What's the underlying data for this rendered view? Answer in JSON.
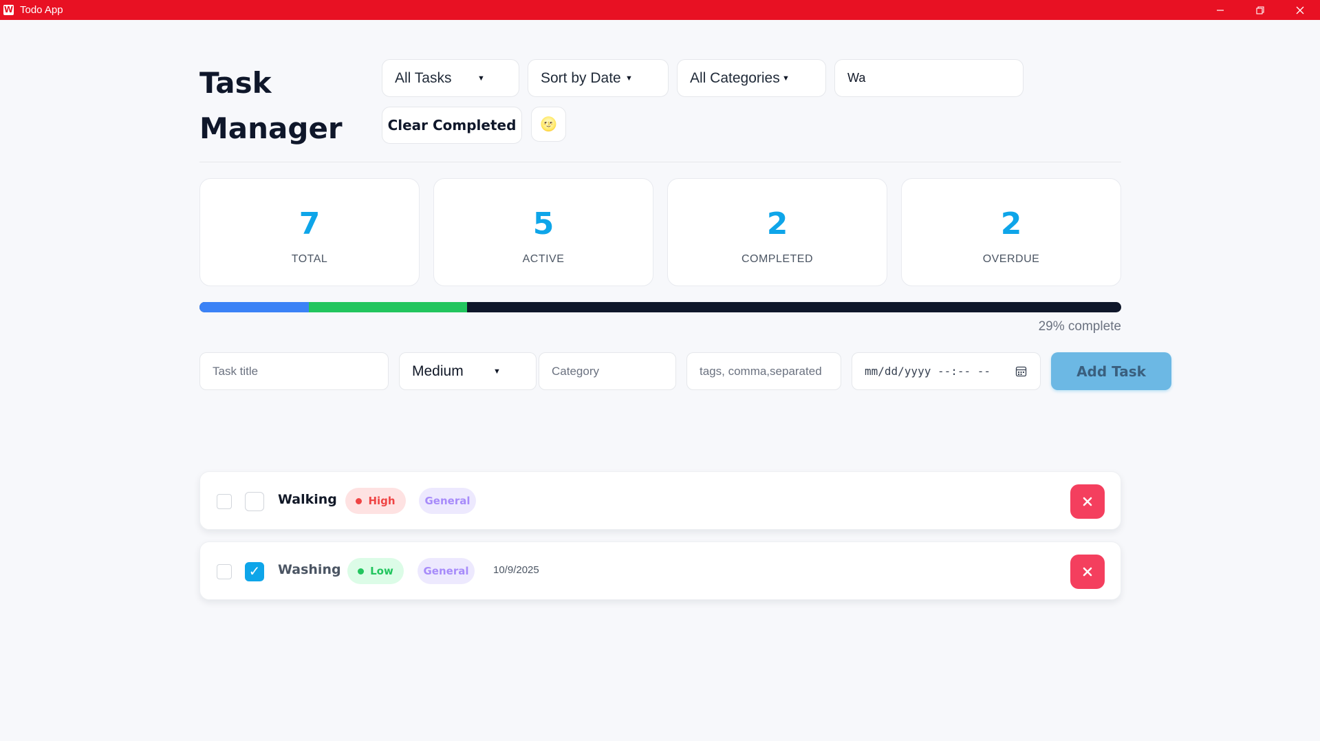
{
  "window": {
    "title": "Todo App",
    "icon_letter": "W"
  },
  "header": {
    "title": "Task Manager",
    "filter": {
      "value": "All Tasks"
    },
    "sort": {
      "value": "Sort by Date"
    },
    "category": {
      "value": "All Categories"
    },
    "search": {
      "value": "Wa"
    },
    "clear_label": "Clear Completed",
    "theme_icon": "🌝"
  },
  "stats": [
    {
      "value": "7",
      "label": "TOTAL"
    },
    {
      "value": "5",
      "label": "ACTIVE"
    },
    {
      "value": "2",
      "label": "COMPLETED"
    },
    {
      "value": "2",
      "label": "OVERDUE"
    }
  ],
  "progress": {
    "percent": 29,
    "text": "29% complete",
    "colors": [
      "#3b82f6",
      "#22c55e"
    ]
  },
  "form": {
    "title_placeholder": "Task title",
    "priority_value": "Medium",
    "category_placeholder": "Category",
    "tags_placeholder": "tags, comma,separated",
    "date_placeholder": "mm/dd/yyyy --:-- --",
    "add_label": "Add Task"
  },
  "tasks": [
    {
      "title": "Walking",
      "priority": "High",
      "category": "General",
      "date": "",
      "completed": false
    },
    {
      "title": "Washing",
      "priority": "Low",
      "category": "General",
      "date": "10/9/2025",
      "completed": true
    }
  ],
  "colors": {
    "titlebar": "#e81123",
    "accent": "#0ea5e9",
    "high_bg": "#fee2e2",
    "high_fg": "#ef4444",
    "low_bg": "#dcfce7",
    "low_fg": "#22c55e",
    "general_bg": "#ede9fe",
    "general_fg": "#a78bfa",
    "delete": "#f43f5e"
  },
  "icons": {
    "close": "x-icon",
    "calendar": "calendar-icon",
    "check": "check-icon"
  }
}
